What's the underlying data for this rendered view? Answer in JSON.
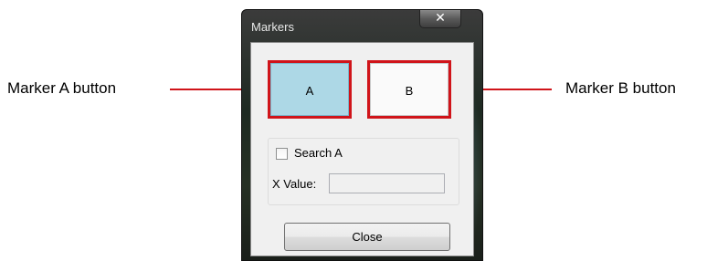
{
  "callouts": {
    "marker_a": "Marker A button",
    "marker_b": "Marker B button",
    "line_color": "#d0141a"
  },
  "dialog": {
    "title": "Markers",
    "close_glyph": "✕",
    "buttons": {
      "marker_a": "A",
      "marker_b": "B",
      "marker_a_color": "#add8e6",
      "highlight_color": "#d0141a"
    },
    "search": {
      "checkbox_label": "Search A",
      "checked": false,
      "x_value_label": "X Value:",
      "x_value": ""
    },
    "close_button": "Close"
  }
}
